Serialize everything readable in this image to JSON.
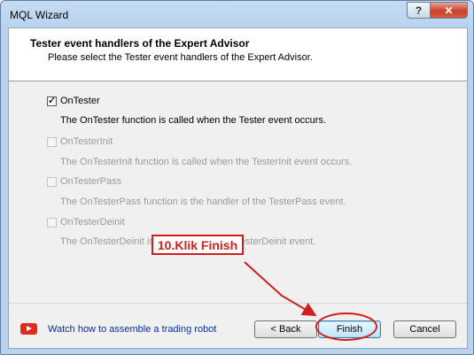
{
  "window": {
    "title": "MQL Wizard",
    "help_label": "?",
    "close_label": "✕"
  },
  "header": {
    "title": "Tester event handlers of the Expert Advisor",
    "subtitle": "Please select the Tester event handlers of the Expert Advisor."
  },
  "options": [
    {
      "label": "OnTester",
      "checked": true,
      "enabled": true,
      "description": "The OnTester function is called when the Tester event occurs."
    },
    {
      "label": "OnTesterInit",
      "checked": false,
      "enabled": false,
      "description": "The OnTesterInit function is called when the TesterInit event occurs."
    },
    {
      "label": "OnTesterPass",
      "checked": false,
      "enabled": false,
      "description": "The OnTesterPass function is the handler of the TesterPass event."
    },
    {
      "label": "OnTesterDeinit",
      "checked": false,
      "enabled": false,
      "description": "The OnTesterDeinit is the handler of the TesterDeinit event."
    }
  ],
  "annotation": {
    "text": "10.Klik Finish",
    "color": "#d21e1e"
  },
  "footer": {
    "video_icon": "youtube-play-icon",
    "link_text": "Watch how to assemble a trading robot",
    "back_label": "< Back",
    "finish_label": "Finish",
    "cancel_label": "Cancel"
  }
}
